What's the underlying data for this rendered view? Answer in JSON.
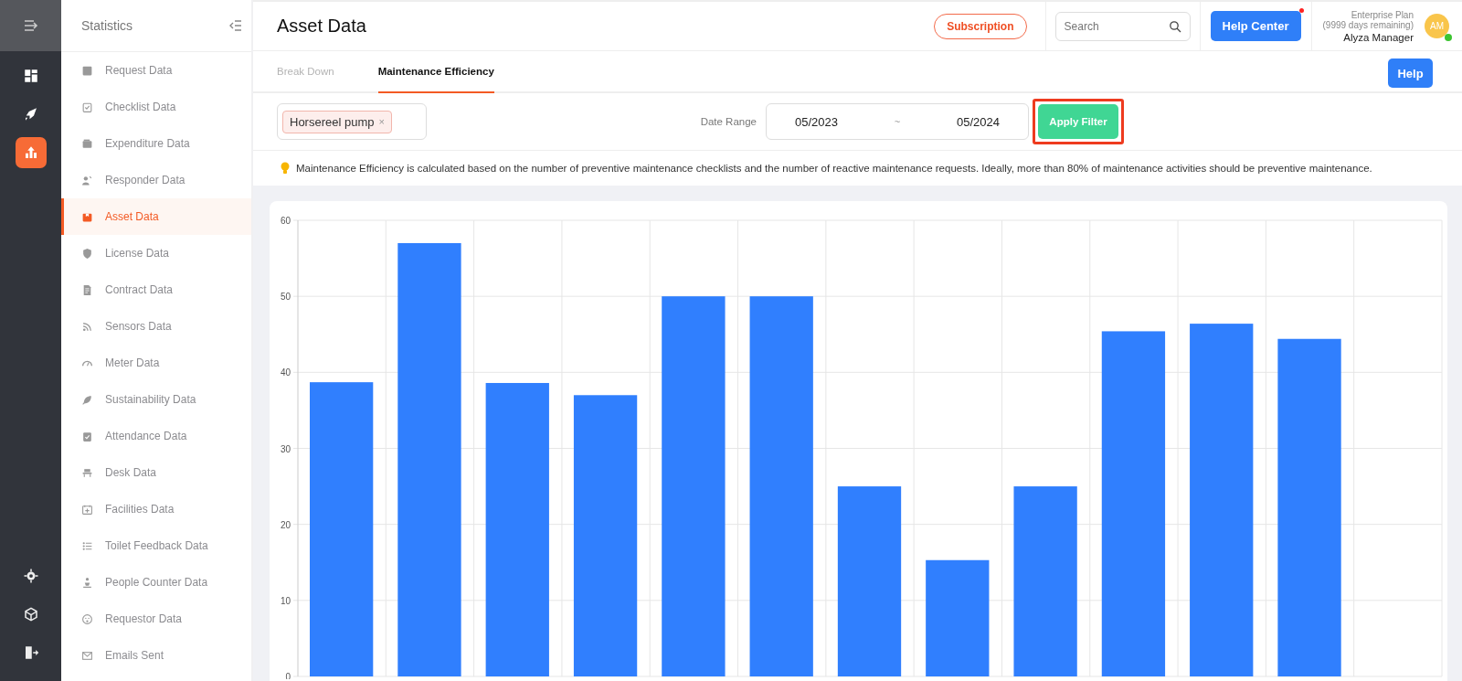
{
  "rail": {
    "items": [
      {
        "selected": false
      },
      {
        "selected": false
      },
      {
        "selected": true
      }
    ],
    "bottom_items": [
      {
        "selected": false
      },
      {
        "selected": false
      },
      {
        "selected": false
      }
    ]
  },
  "sidebar": {
    "title": "Statistics",
    "items": [
      {
        "label": "Request Data",
        "selected": false
      },
      {
        "label": "Checklist Data",
        "selected": false
      },
      {
        "label": "Expenditure Data",
        "selected": false
      },
      {
        "label": "Responder Data",
        "selected": false
      },
      {
        "label": "Asset Data",
        "selected": true
      },
      {
        "label": "License Data",
        "selected": false
      },
      {
        "label": "Contract Data",
        "selected": false
      },
      {
        "label": "Sensors Data",
        "selected": false
      },
      {
        "label": "Meter Data",
        "selected": false
      },
      {
        "label": "Sustainability Data",
        "selected": false
      },
      {
        "label": "Attendance Data",
        "selected": false
      },
      {
        "label": "Desk Data",
        "selected": false
      },
      {
        "label": "Facilities Data",
        "selected": false
      },
      {
        "label": "Toilet Feedback Data",
        "selected": false
      },
      {
        "label": "People Counter Data",
        "selected": false
      },
      {
        "label": "Requestor Data",
        "selected": false
      },
      {
        "label": "Emails Sent",
        "selected": false
      }
    ]
  },
  "header": {
    "title": "Asset Data",
    "subscription": "Subscription",
    "search": {
      "placeholder": "Search"
    },
    "help_center": "Help Center",
    "user": {
      "plan": "Enterprise Plan",
      "remaining": "(9999 days remaining)",
      "name": "Alyza Manager",
      "initials": "AM"
    }
  },
  "tabs": [
    {
      "label": "Break Down",
      "selected": false
    },
    {
      "label": "Maintenance Efficiency",
      "selected": true
    }
  ],
  "help_button": "Help",
  "filter": {
    "tags": [
      {
        "label": "Horsereel pump",
        "remove": "×"
      }
    ],
    "date_label": "Date Range",
    "date_from": "05/2023",
    "date_separator": "~",
    "date_to": "05/2024",
    "apply": "Apply Filter",
    "apply_highlighted": true
  },
  "info": "Maintenance Efficiency is calculated based on the number of preventive maintenance checklists and the number of reactive maintenance requests. Ideally, more than 80% of maintenance activities should be preventive maintenance.",
  "chart_data": {
    "type": "bar",
    "grid": true,
    "ylim": [
      0,
      60
    ],
    "yticks": [
      0,
      10,
      20,
      30,
      40,
      50,
      60
    ],
    "series": [
      {
        "color": "#307ffe",
        "values": [
          38.7,
          57,
          38.6,
          37,
          50,
          50,
          25,
          15.3,
          25,
          45.4,
          46.4,
          44.4,
          null
        ]
      }
    ]
  }
}
